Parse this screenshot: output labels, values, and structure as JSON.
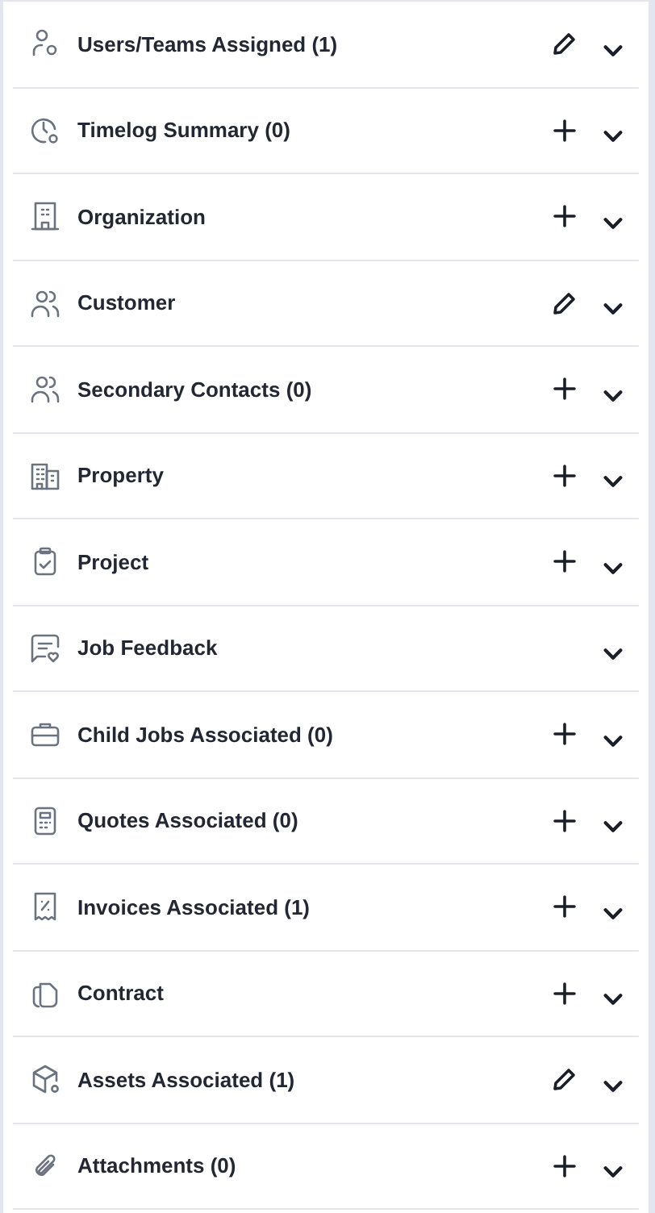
{
  "sections": [
    {
      "title": "Users/Teams Assigned (1)",
      "kind": "user-pin",
      "editable": true,
      "addable": false
    },
    {
      "title": "Timelog Summary (0)",
      "kind": "clock",
      "editable": false,
      "addable": true
    },
    {
      "title": "Organization",
      "kind": "building",
      "editable": false,
      "addable": true
    },
    {
      "title": "Customer",
      "kind": "people",
      "editable": true,
      "addable": false
    },
    {
      "title": "Secondary Contacts (0)",
      "kind": "people",
      "editable": false,
      "addable": true
    },
    {
      "title": "Property",
      "kind": "buildings",
      "editable": false,
      "addable": true
    },
    {
      "title": "Project",
      "kind": "clipboard",
      "editable": false,
      "addable": true
    },
    {
      "title": "Job Feedback",
      "kind": "feedback",
      "editable": false,
      "addable": false
    },
    {
      "title": "Child Jobs Associated (0)",
      "kind": "briefcase",
      "editable": false,
      "addable": true
    },
    {
      "title": "Quotes Associated (0)",
      "kind": "calculator",
      "editable": false,
      "addable": true
    },
    {
      "title": "Invoices Associated (1)",
      "kind": "receipt",
      "editable": false,
      "addable": true
    },
    {
      "title": "Contract",
      "kind": "copy",
      "editable": false,
      "addable": true
    },
    {
      "title": "Assets Associated (1)",
      "kind": "box",
      "editable": true,
      "addable": false
    },
    {
      "title": "Attachments (0)",
      "kind": "paperclip",
      "editable": false,
      "addable": true
    }
  ]
}
